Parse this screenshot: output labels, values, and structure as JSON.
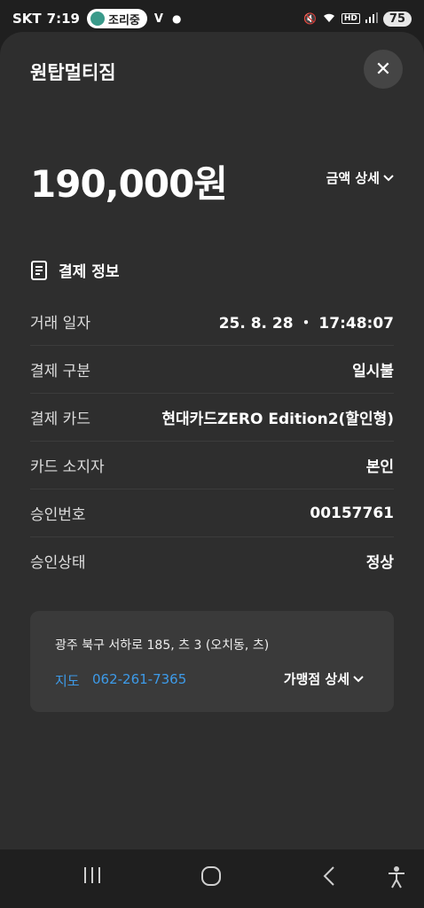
{
  "status_bar": {
    "carrier": "SKT",
    "time": "7:19",
    "pill_label": "조리중",
    "app_badge": "V",
    "battery": "75"
  },
  "sheet": {
    "title": "원탑멀티짐",
    "amount": "190,000원",
    "amount_detail_label": "금액 상세",
    "section_title": "결제 정보",
    "rows": [
      {
        "label": "거래 일자",
        "value": "25. 8. 28 ・ 17:48:07"
      },
      {
        "label": "결제 구분",
        "value": "일시불"
      },
      {
        "label": "결제 카드",
        "value": "현대카드ZERO Edition2(할인형)"
      },
      {
        "label": "카드 소지자",
        "value": "본인"
      },
      {
        "label": "승인번호",
        "value": "00157761"
      },
      {
        "label": "승인상태",
        "value": "정상"
      }
    ],
    "merchant": {
      "address": "광주 북구 서하로 185, 츠 3 (오치동, 츠)",
      "map_link": "지도",
      "phone": "062-261-7365",
      "detail_label": "가맹점 상세"
    }
  }
}
